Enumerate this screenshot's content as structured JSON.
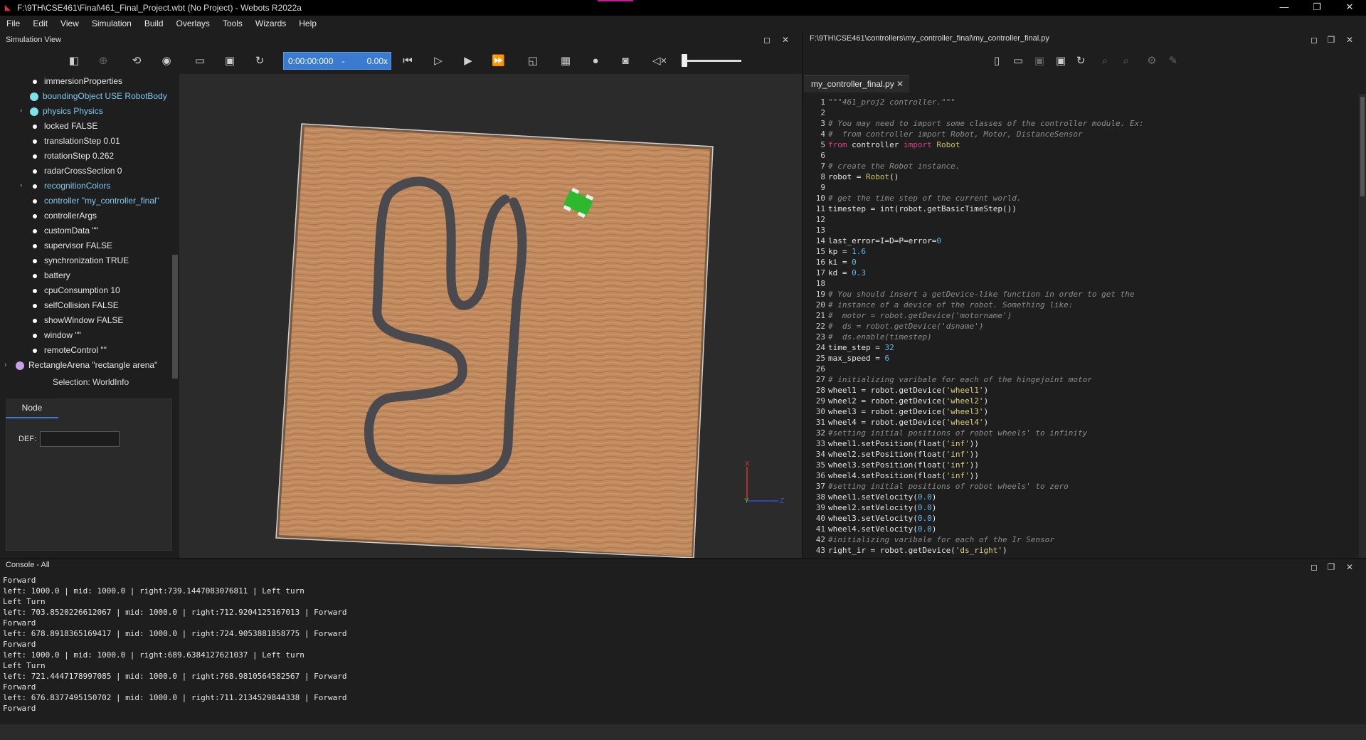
{
  "window": {
    "title": "F:\\9TH\\CSE461\\Final\\461_Final_Project.wbt (No Project) - Webots R2022a"
  },
  "menu": [
    "File",
    "Edit",
    "View",
    "Simulation",
    "Build",
    "Overlays",
    "Tools",
    "Wizards",
    "Help"
  ],
  "simulation_view": {
    "title": "Simulation View",
    "time": "0:00:00:000",
    "separator": "-",
    "speed": "0.00x"
  },
  "scene_tree": [
    {
      "label": "immersionProperties",
      "kind": "field"
    },
    {
      "label": "boundingObject USE RobotBody",
      "kind": "node",
      "color": "blue"
    },
    {
      "label": "physics Physics",
      "kind": "node",
      "color": "blue",
      "expandable": true
    },
    {
      "label": "locked FALSE",
      "kind": "field"
    },
    {
      "label": "translationStep 0.01",
      "kind": "field"
    },
    {
      "label": "rotationStep 0.262",
      "kind": "field"
    },
    {
      "label": "radarCrossSection 0",
      "kind": "field"
    },
    {
      "label": "recognitionColors",
      "kind": "field",
      "color": "blue",
      "expandable": true
    },
    {
      "label": "controller \"my_controller_final\"",
      "kind": "field",
      "color": "blue"
    },
    {
      "label": "controllerArgs",
      "kind": "field"
    },
    {
      "label": "customData \"\"",
      "kind": "field"
    },
    {
      "label": "supervisor FALSE",
      "kind": "field"
    },
    {
      "label": "synchronization TRUE",
      "kind": "field"
    },
    {
      "label": "battery",
      "kind": "field"
    },
    {
      "label": "cpuConsumption 10",
      "kind": "field"
    },
    {
      "label": "selfCollision FALSE",
      "kind": "field"
    },
    {
      "label": "showWindow FALSE",
      "kind": "field"
    },
    {
      "label": "window \"\"",
      "kind": "field"
    },
    {
      "label": "remoteControl \"\"",
      "kind": "field"
    },
    {
      "label": "RectangleArena \"rectangle arena\"",
      "kind": "top",
      "expandable": true
    }
  ],
  "field_editor": {
    "selection": "Selection: WorldInfo",
    "tab": "Node",
    "def_label": "DEF:",
    "def_value": ""
  },
  "editor": {
    "path": "F:\\9TH\\CSE461\\controllers\\my_controller_final\\my_controller_final.py",
    "tab": "my_controller_final.py",
    "lines": [
      "\"\"\"461_proj2 controller.\"\"\"",
      "",
      "# You may need to import some classes of the controller module. Ex:",
      "#  from controller import Robot, Motor, DistanceSensor",
      "from controller import Robot",
      "",
      "# create the Robot instance.",
      "robot = Robot()",
      "",
      "# get the time step of the current world.",
      "timestep = int(robot.getBasicTimeStep())",
      "",
      "",
      "last_error=I=D=P=error=0",
      "kp = 1.6",
      "ki = 0",
      "kd = 0.3",
      "",
      "# You should insert a getDevice-like function in order to get the",
      "# instance of a device of the robot. Something like:",
      "#  motor = robot.getDevice('motorname')",
      "#  ds = robot.getDevice('dsname')",
      "#  ds.enable(timestep)",
      "time_step = 32",
      "max_speed = 6",
      "",
      "# initializing varibale for each of the hingejoint motor",
      "wheel1 = robot.getDevice('wheel1')",
      "wheel2 = robot.getDevice('wheel2')",
      "wheel3 = robot.getDevice('wheel3')",
      "wheel4 = robot.getDevice('wheel4')",
      "#setting initial positions of robot wheels' to infinity",
      "wheel1.setPosition(float('inf'))",
      "wheel2.setPosition(float('inf'))",
      "wheel3.setPosition(float('inf'))",
      "wheel4.setPosition(float('inf'))",
      "#setting initial positions of robot wheels' to zero",
      "wheel1.setVelocity(0.0)",
      "wheel2.setVelocity(0.0)",
      "wheel3.setVelocity(0.0)",
      "wheel4.setVelocity(0.0)",
      "#initializing varibale for each of the Ir Sensor",
      "right_ir = robot.getDevice('ds_right')"
    ]
  },
  "console": {
    "title": "Console - All",
    "lines": [
      "Forward",
      "left: 1000.0 | mid: 1000.0 | right:739.1447083076811 | Left turn",
      "Left Turn",
      "left: 703.8520226612067 | mid: 1000.0 | right:712.9204125167013 | Forward",
      "Forward",
      "left: 678.8918365169417 | mid: 1000.0 | right:724.9053881858775 | Forward",
      "Forward",
      "left: 1000.0 | mid: 1000.0 | right:689.6384127621037 | Left turn",
      "Left Turn",
      "left: 721.4447178997085 | mid: 1000.0 | right:768.9810564582567 | Forward",
      "Forward",
      "left: 676.8377495150702 | mid: 1000.0 | right:711.2134529844338 | Forward",
      "Forward"
    ]
  },
  "axes": {
    "x": "X",
    "y": "Y",
    "z": "Z"
  },
  "colors": {
    "accent": "#3a7bd0",
    "comment": "#8c8c8c",
    "keyword": "#e0408a",
    "number": "#5fb8e8",
    "class": "#c9c060",
    "string": "#e0d080",
    "robot": "#2db82d",
    "track": "#4a4a4e"
  }
}
